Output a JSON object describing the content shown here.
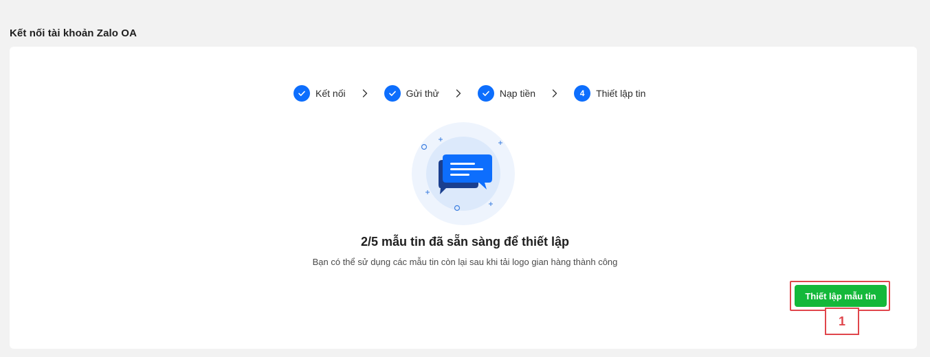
{
  "page": {
    "title": "Kết nối tài khoản Zalo OA"
  },
  "stepper": {
    "steps": [
      {
        "label": "Kết nối",
        "state": "done",
        "icon": "check-icon"
      },
      {
        "label": "Gửi thử",
        "state": "done",
        "icon": "check-icon"
      },
      {
        "label": "Nạp tiền",
        "state": "done",
        "icon": "check-icon"
      },
      {
        "label": "Thiết lập tin",
        "state": "current",
        "number": "4"
      }
    ],
    "separator_icon": "chevron-right-icon",
    "active_color": "#0d6efd"
  },
  "illustration": {
    "icon": "chat-bubbles-icon",
    "colors": {
      "outer_circle": "#eef4fd",
      "inner_circle": "#dce9fb",
      "front_bubble": "#0d6efd",
      "back_bubble": "#1a3f8f"
    }
  },
  "content": {
    "headline": "2/5 mẫu tin đã sẵn sàng để thiết lập",
    "subtext": "Bạn có thể sử dụng các mẫu tin còn lại sau khi tải logo gian hàng thành công"
  },
  "actions": {
    "setup_button_label": "Thiết lập mẫu tin",
    "button_color": "#14b83a"
  },
  "annotation": {
    "marker_label": "1",
    "color": "#e0454b"
  }
}
